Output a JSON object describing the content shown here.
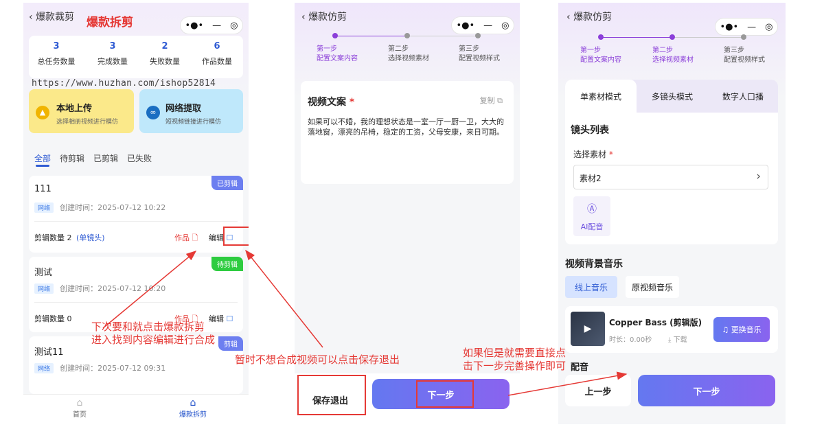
{
  "screen1": {
    "back_title": "爆款裁剪",
    "red_title": "爆款拆剪",
    "capsule": {
      "more": "•●•",
      "minimize": "—",
      "close": "◎"
    },
    "stats": [
      {
        "value": "3",
        "label": "总任务数量"
      },
      {
        "value": "3",
        "label": "完成数量"
      },
      {
        "value": "2",
        "label": "失败数量"
      },
      {
        "value": "6",
        "label": "作品数量"
      }
    ],
    "watermark": "https://www.huzhan.com/ishop52814",
    "upload": {
      "title": "本地上传",
      "sub": "选择相册视频进行模仿"
    },
    "fetch": {
      "title": "网络提取",
      "sub": "短视频链接进行模仿"
    },
    "tabs": [
      "全部",
      "待剪辑",
      "已剪辑",
      "已失败"
    ],
    "tasks": [
      {
        "name": "111",
        "tag": "网络",
        "time": "创建时间：2025-07-12 10:22",
        "badge": "已剪辑",
        "count": "剪辑数量 2",
        "mode": "(单镜头)",
        "works": "作品",
        "edit": "编辑"
      },
      {
        "name": "测试",
        "tag": "网络",
        "time": "创建时间：2025-07-12 10:20",
        "badge": "待剪辑",
        "count": "剪辑数量 0",
        "works": "作品",
        "edit": "编辑"
      },
      {
        "name": "测试11",
        "tag": "网络",
        "time": "创建时间：2025-07-12 09:31",
        "badge": "剪辑"
      }
    ],
    "nav": [
      {
        "label": "首页"
      },
      {
        "label": "爆款拆剪"
      }
    ]
  },
  "screen2": {
    "back_title": "爆款仿剪",
    "steps": [
      {
        "title": "第一步",
        "sub": "配置文案内容"
      },
      {
        "title": "第二步",
        "sub": "选择视频素材"
      },
      {
        "title": "第三步",
        "sub": "配置视频样式"
      }
    ],
    "copy_title": "视频文案",
    "required": "*",
    "copy_btn": "复制",
    "copy_text": "如果可以不婚，我的理想状态是一室一厅一厨一卫，大大的落地窗，漂亮的吊椅，稳定的工资，父母安康，来日可期。",
    "save_exit": "保存退出",
    "next": "下一步"
  },
  "screen3": {
    "back_title": "爆款仿剪",
    "steps": [
      {
        "title": "第一步",
        "sub": "配置文案内容"
      },
      {
        "title": "第二步",
        "sub": "选择视频素材"
      },
      {
        "title": "第三步",
        "sub": "配置视频样式"
      }
    ],
    "mode_tabs": [
      "单素材模式",
      "多镜头模式",
      "数字人口播"
    ],
    "shot_list": "镜头列表",
    "select_label": "选择素材",
    "required": "*",
    "select_value": "素材2",
    "ai_label": "AI配音",
    "bgm_title": "视频背景音乐",
    "bgm_tabs": [
      "线上音乐",
      "原视频音乐"
    ],
    "music": {
      "name": "Copper Bass (剪辑版)",
      "duration": "时长：0.00秒",
      "download": "下载",
      "change": "更换音乐"
    },
    "hidden_label": "配音",
    "prev": "上一步",
    "next": "下一步"
  },
  "annotations": {
    "a1_line1": "下次要和就点击爆款拆剪",
    "a1_line2": "进入找到内容编辑进行合成",
    "a2": "暂时不想合成视频可以点击保存退出",
    "a3_line1": "如果但是就需要直接点",
    "a3_line2": "击下一步完善操作即可"
  },
  "colors": {
    "accent": "#2f5bd3",
    "brand_purple": "#8b3fd9",
    "annotation_red": "#e53935",
    "done_badge": "#6d7ff0",
    "pending_badge": "#2ecc40"
  }
}
